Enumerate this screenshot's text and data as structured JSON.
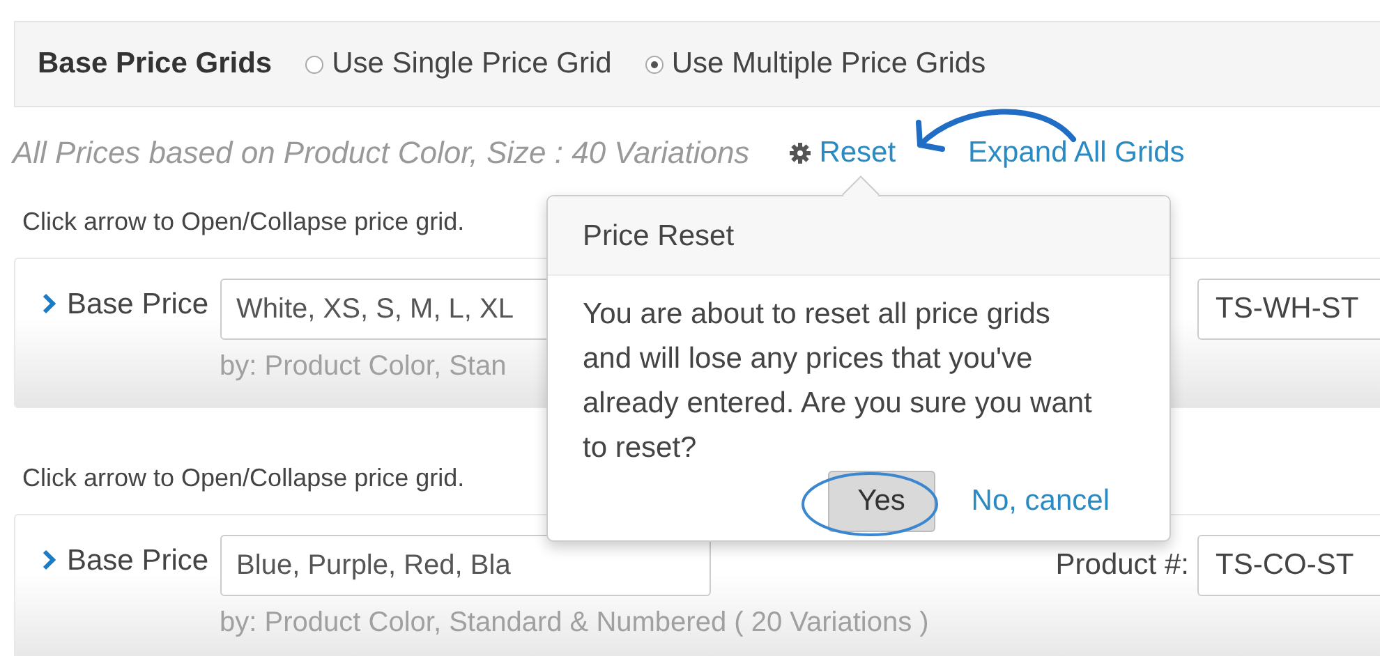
{
  "header": {
    "title": "Base Price Grids",
    "options": [
      {
        "label": "Use Single Price Grid",
        "selected": false
      },
      {
        "label": "Use Multiple Price Grids",
        "selected": true
      }
    ]
  },
  "summary": {
    "text": "All Prices based on Product Color, Size : 40 Variations",
    "links": [
      {
        "label": "Reset",
        "kind": "gear"
      },
      {
        "label": "Expand All Grids",
        "kind": "plain"
      }
    ]
  },
  "grids": [
    {
      "hint": "Click arrow to Open/Collapse price grid.",
      "label": "Base Price",
      "value": "White, XS, S, M, L, XL",
      "by": "by: Product Color, Stan",
      "product_value": "TS-WH-ST"
    },
    {
      "hint": "Click arrow to Open/Collapse price grid.",
      "label": "Base Price",
      "value": "Blue, Purple, Red, Bla",
      "by": "by: Product Color, Standard & Numbered ( 20 Variations )",
      "product_label": "Product #:",
      "product_value": "TS-CO-ST"
    }
  ],
  "popover": {
    "title": "Price Reset",
    "message": "You are about to reset all price grids and will lose any prices that you've already entered. Are you sure you want to reset?",
    "buttons": [
      {
        "label": "Yes",
        "kind": "button"
      },
      {
        "label": "No, cancel",
        "kind": "link"
      }
    ]
  }
}
